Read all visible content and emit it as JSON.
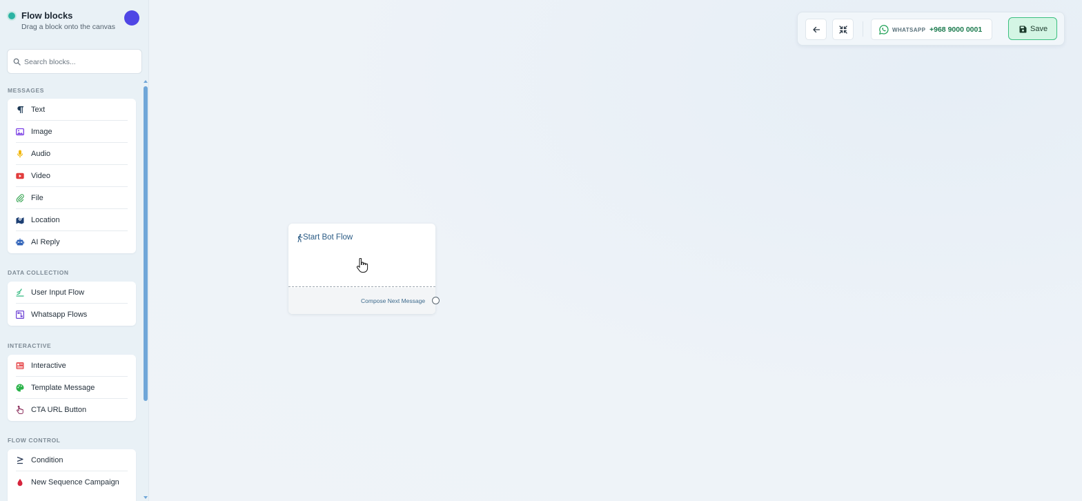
{
  "sidebar": {
    "title": "Flow blocks",
    "subtitle": "Drag a block onto the canvas",
    "search_placeholder": "Search blocks...",
    "sections": [
      {
        "label": "MESSAGES",
        "items": [
          {
            "label": "Text",
            "icon": "paragraph-icon",
            "color": "#1f3b57"
          },
          {
            "label": "Image",
            "icon": "image-icon",
            "color": "#7b3fe4"
          },
          {
            "label": "Audio",
            "icon": "microphone-icon",
            "color": "#f2b70a"
          },
          {
            "label": "Video",
            "icon": "youtube-icon",
            "color": "#e23d3d"
          },
          {
            "label": "File",
            "icon": "paperclip-icon",
            "color": "#3aa655"
          },
          {
            "label": "Location",
            "icon": "map-location-icon",
            "color": "#1d3f73"
          },
          {
            "label": "AI Reply",
            "icon": "robot-icon",
            "color": "#2f62b8"
          }
        ]
      },
      {
        "label": "DATA COLLECTION",
        "items": [
          {
            "label": "User Input Flow",
            "icon": "signal-icon",
            "color": "#2fb87d"
          },
          {
            "label": "Whatsapp Flows",
            "icon": "flow-diagram-icon",
            "color": "#6b3fd4"
          }
        ]
      },
      {
        "label": "INTERACTIVE",
        "items": [
          {
            "label": "Interactive",
            "icon": "list-card-icon",
            "color": "#e8575a"
          },
          {
            "label": "Template Message",
            "icon": "palette-icon",
            "color": "#2bb34a"
          },
          {
            "label": "CTA URL Button",
            "icon": "pointer-hand-icon",
            "color": "#8a2c5a"
          }
        ]
      },
      {
        "label": "FLOW CONTROL",
        "items": [
          {
            "label": "Condition",
            "icon": "greater-equal-icon",
            "color": "#2a3a56"
          },
          {
            "label": "New Sequence Campaign",
            "icon": "droplet-icon",
            "color": "#d6243c"
          }
        ]
      }
    ]
  },
  "toolbar": {
    "whatsapp_label": "WHATSAPP",
    "whatsapp_number": "+968 9000 0001",
    "save_label": "Save"
  },
  "node": {
    "title": "Start Bot Flow",
    "next_label": "Compose Next Message"
  },
  "colors": {
    "accent_green": "#3bbf7f",
    "avatar": "#4f46e5",
    "status_dot": "#2bb3a3",
    "scrollbar": "#6fa6d8"
  }
}
